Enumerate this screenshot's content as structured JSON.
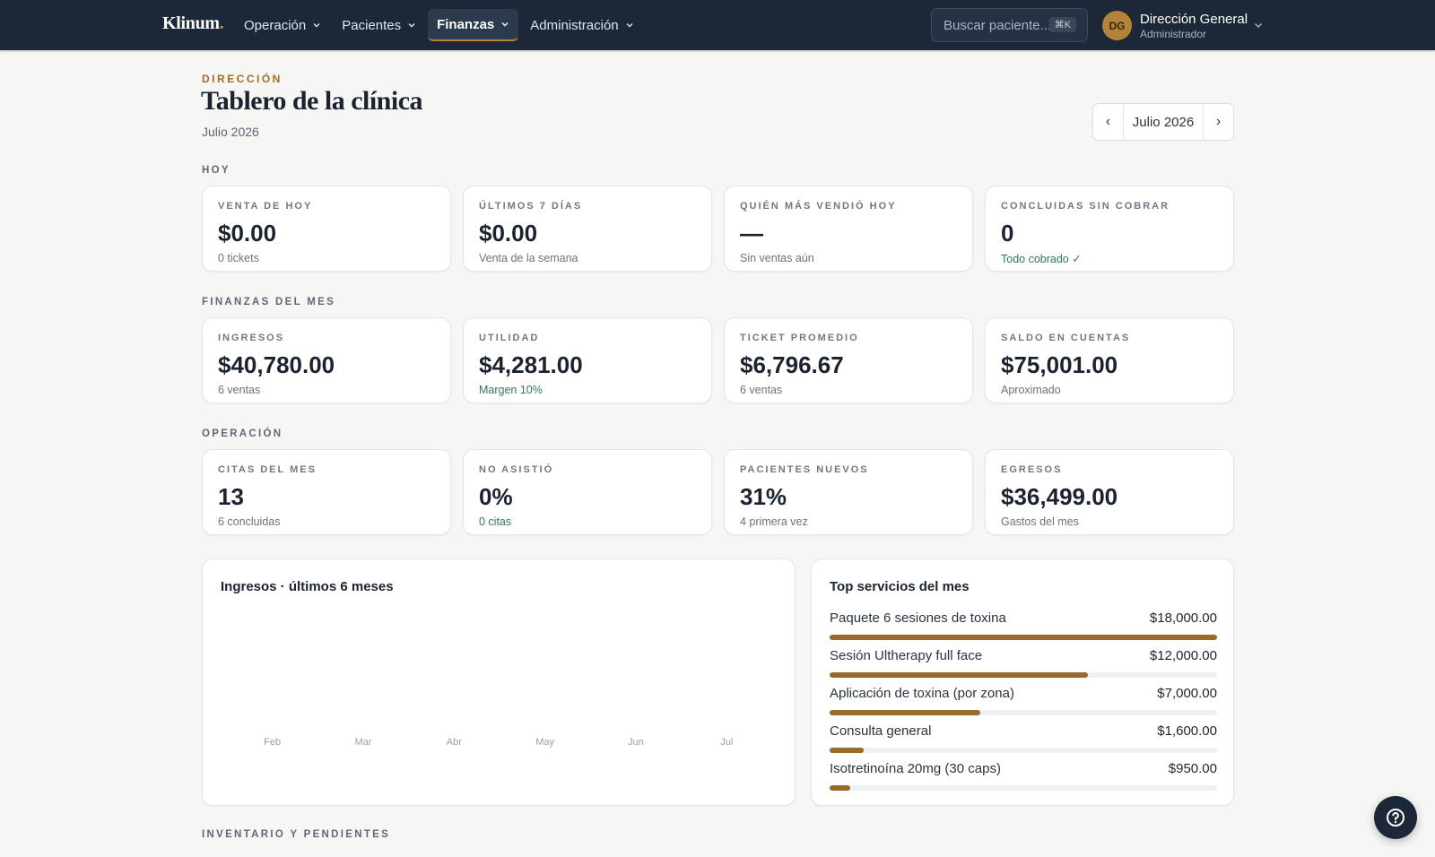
{
  "nav": {
    "logo": "Klinum",
    "logo_dot": ".",
    "menu": [
      {
        "label": "Operación",
        "active": false
      },
      {
        "label": "Pacientes",
        "active": false
      },
      {
        "label": "Finanzas",
        "active": true
      },
      {
        "label": "Administración",
        "active": false
      }
    ],
    "search_placeholder": "Buscar paciente...",
    "search_shortcut": "⌘K",
    "user": {
      "initials": "DG",
      "name": "Dirección General",
      "role": "Administrador"
    }
  },
  "header": {
    "eyebrow": "DIRECCIÓN",
    "title": "Tablero de la clínica",
    "subtitle": "Julio 2026",
    "month_label": "Julio 2026",
    "prev": "‹",
    "next": "›"
  },
  "sections": {
    "hoy": {
      "label": "HOY",
      "cards": [
        {
          "label": "Venta de hoy",
          "value": "$0.00",
          "sub": "0 tickets",
          "tone": "muted"
        },
        {
          "label": "Últimos 7 días",
          "value": "$0.00",
          "sub": "Venta de la semana",
          "tone": "muted"
        },
        {
          "label": "Quién más vendió hoy",
          "value": "—",
          "sub": "Sin ventas aún",
          "tone": "muted"
        },
        {
          "label": "Concluidas sin cobrar",
          "value": "0",
          "sub": "Todo cobrado ✓",
          "tone": "green"
        }
      ]
    },
    "finanzas": {
      "label": "FINANZAS DEL MES",
      "cards": [
        {
          "label": "Ingresos",
          "value": "$40,780.00",
          "sub": "6 ventas",
          "tone": "muted"
        },
        {
          "label": "Utilidad",
          "value": "$4,281.00",
          "sub": "Margen 10%",
          "tone": "green"
        },
        {
          "label": "Ticket promedio",
          "value": "$6,796.67",
          "sub": "6 ventas",
          "tone": "muted"
        },
        {
          "label": "Saldo en cuentas",
          "value": "$75,001.00",
          "sub": "Aproximado",
          "tone": "muted"
        }
      ]
    },
    "operacion": {
      "label": "OPERACIÓN",
      "cards": [
        {
          "label": "Citas del mes",
          "value": "13",
          "sub": "6 concluidas",
          "tone": "muted"
        },
        {
          "label": "No asistió",
          "value": "0%",
          "sub": "0 citas",
          "tone": "green"
        },
        {
          "label": "Pacientes nuevos",
          "value": "31%",
          "sub": "4 primera vez",
          "tone": "muted"
        },
        {
          "label": "Egresos",
          "value": "$36,499.00",
          "sub": "Gastos del mes",
          "tone": "muted"
        }
      ]
    },
    "inventario": {
      "label": "INVENTARIO Y PENDIENTES"
    }
  },
  "revenue_chart": {
    "title": "Ingresos · últimos 6 meses",
    "chart_data": {
      "type": "bar",
      "categories": [
        "Feb",
        "Mar",
        "Abr",
        "May",
        "Jun",
        "Jul"
      ],
      "values": [],
      "title": "Ingresos · últimos 6 meses"
    }
  },
  "top_services": {
    "title": "Top servicios del mes",
    "items": [
      {
        "name": "Paquete 6 sesiones de toxina",
        "amount": "$18,000.00",
        "value": 18000
      },
      {
        "name": "Sesión Ultherapy full face",
        "amount": "$12,000.00",
        "value": 12000
      },
      {
        "name": "Aplicación de toxina (por zona)",
        "amount": "$7,000.00",
        "value": 7000
      },
      {
        "name": "Consulta general",
        "amount": "$1,600.00",
        "value": 1600
      },
      {
        "name": "Isotretinoína 20mg (30 caps)",
        "amount": "$950.00",
        "value": 950
      }
    ]
  },
  "colors": {
    "nav_bg": "#1c2838",
    "accent": "#b5823a",
    "bar": "#9a6a2d",
    "positive": "#2f7a52"
  },
  "help": {
    "icon": "help-circle-icon"
  }
}
